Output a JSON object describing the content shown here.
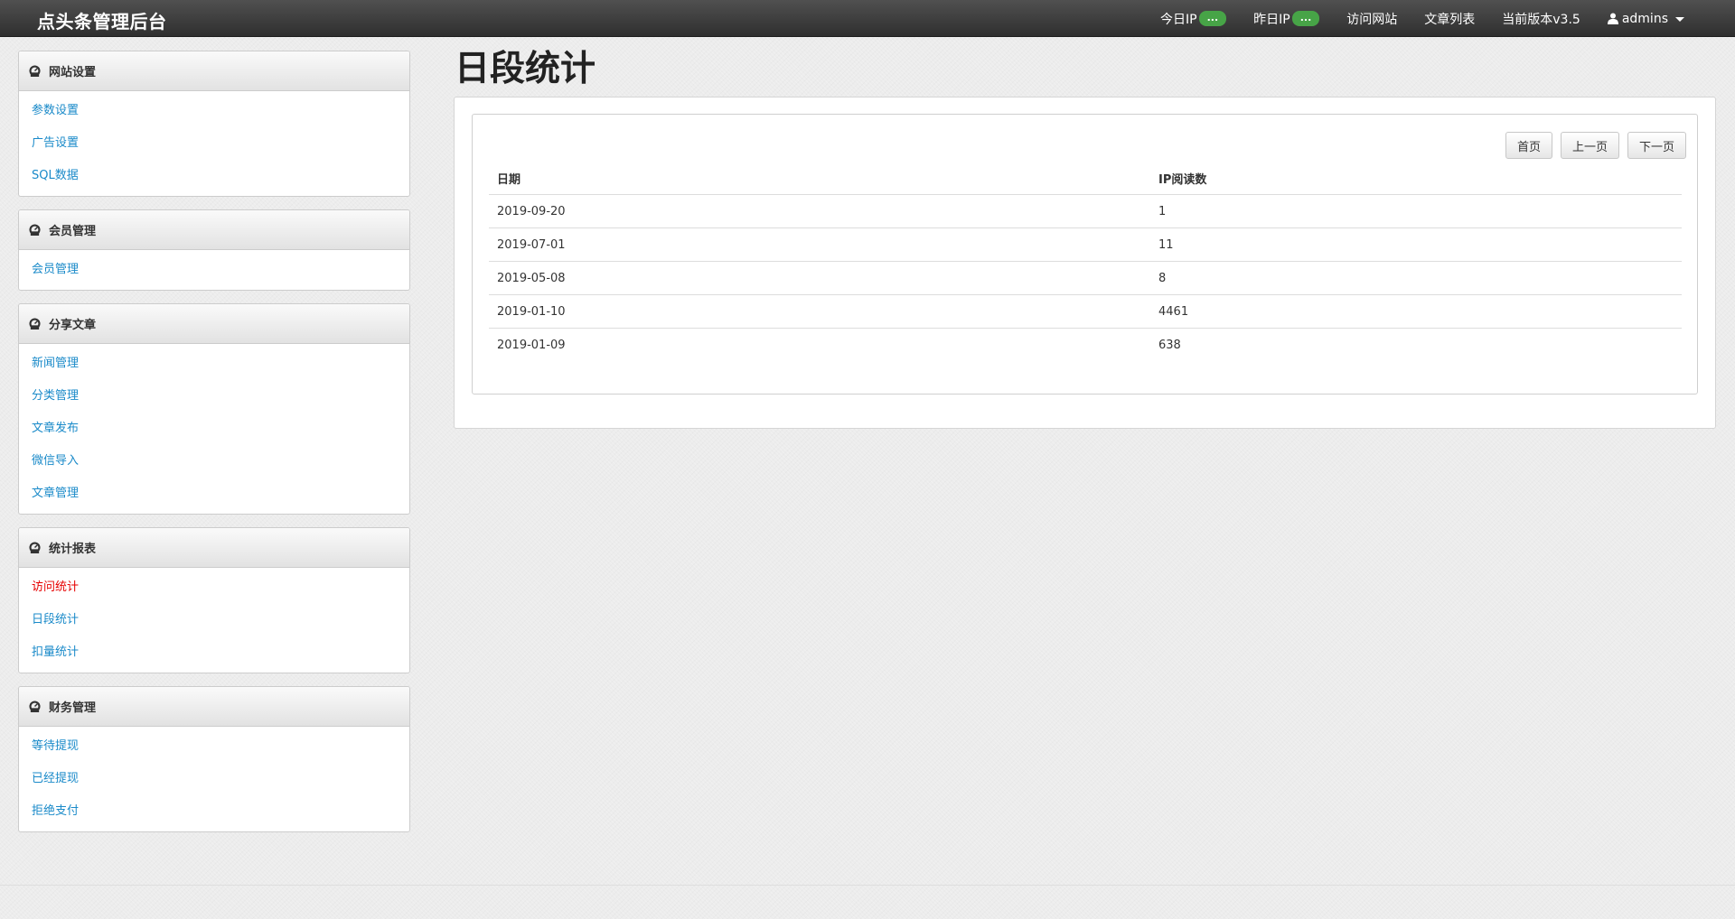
{
  "navbar": {
    "brand": "点头条管理后台",
    "today_ip_label": "今日IP",
    "today_ip_badge": "...",
    "yesterday_ip_label": "昨日IP",
    "yesterday_ip_badge": "...",
    "visit_site": "访问网站",
    "article_list": "文章列表",
    "version": "当前版本v3.5",
    "user": "admins",
    "accent_badge_color": "#47a447"
  },
  "sidebar": {
    "sections": [
      {
        "title": "网站设置",
        "items": [
          {
            "label": "参数设置"
          },
          {
            "label": "广告设置"
          },
          {
            "label": "SQL数据"
          }
        ]
      },
      {
        "title": "会员管理",
        "items": [
          {
            "label": "会员管理"
          }
        ]
      },
      {
        "title": "分享文章",
        "items": [
          {
            "label": "新闻管理"
          },
          {
            "label": "分类管理"
          },
          {
            "label": "文章发布"
          },
          {
            "label": "微信导入"
          },
          {
            "label": "文章管理"
          }
        ]
      },
      {
        "title": "统计报表",
        "items": [
          {
            "label": "访问统计",
            "active": true
          },
          {
            "label": "日段统计"
          },
          {
            "label": "扣量统计"
          }
        ]
      },
      {
        "title": "财务管理",
        "items": [
          {
            "label": "等待提现"
          },
          {
            "label": "已经提现"
          },
          {
            "label": "拒绝支付"
          }
        ]
      }
    ]
  },
  "main": {
    "title": "日段统计",
    "pager": {
      "first": "首页",
      "prev": "上一页",
      "next": "下一页"
    },
    "table": {
      "headers": [
        "日期",
        "IP阅读数"
      ],
      "rows": [
        [
          "2019-09-20",
          "1"
        ],
        [
          "2019-07-01",
          "11"
        ],
        [
          "2019-05-08",
          "8"
        ],
        [
          "2019-01-10",
          "4461"
        ],
        [
          "2019-01-09",
          "638"
        ]
      ]
    }
  }
}
